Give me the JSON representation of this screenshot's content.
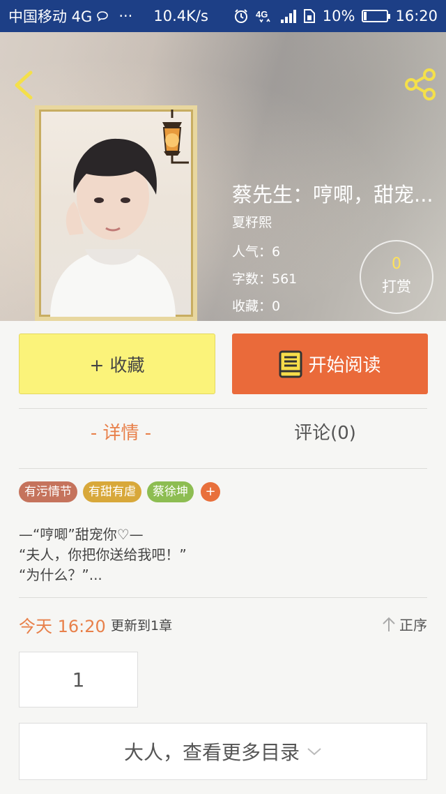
{
  "status_bar": {
    "carrier": "中国移动 4G",
    "dots": "···",
    "net_speed": "10.4K/s",
    "battery_percent": "10%",
    "time": "16:20",
    "icons": [
      "chat-bubble-icon",
      "alarm-icon",
      "4g-data-icon",
      "signal-icon",
      "sim-icon",
      "battery-icon"
    ]
  },
  "header": {
    "back_icon": "chevron-left-icon",
    "share_icon": "share-icon"
  },
  "book": {
    "title": "蔡先生：哼唧，甜宠...",
    "author": "夏籽熙",
    "popularity": "人气：6",
    "word_count": "字数：561",
    "favorites": "收藏：0"
  },
  "tip": {
    "count": "0",
    "label": "打赏"
  },
  "actions": {
    "collect_label": "+ 收藏",
    "read_label": "开始阅读"
  },
  "tabs": {
    "detail": "- 详情 -",
    "comments": "评论(0)"
  },
  "tags": [
    "有污情节",
    "有甜有虐",
    "蔡徐坤"
  ],
  "tag_add": "+",
  "summary": {
    "line1": "—“哼唧”甜宠你♡—",
    "line2": "“夫人，你把你送给我吧！”",
    "line3": "“为什么？”..."
  },
  "update": {
    "time": "今天 16:20",
    "text": "更新到1章",
    "sort_label": "正序"
  },
  "chapter_number": "1",
  "more_catalog_label": "大人，查看更多目录",
  "colors": {
    "status_bar": "#1d3f86",
    "accent_orange": "#ea6a3a",
    "collect_yellow": "#fbf37a",
    "tip_count_yellow": "#ffe25a"
  }
}
